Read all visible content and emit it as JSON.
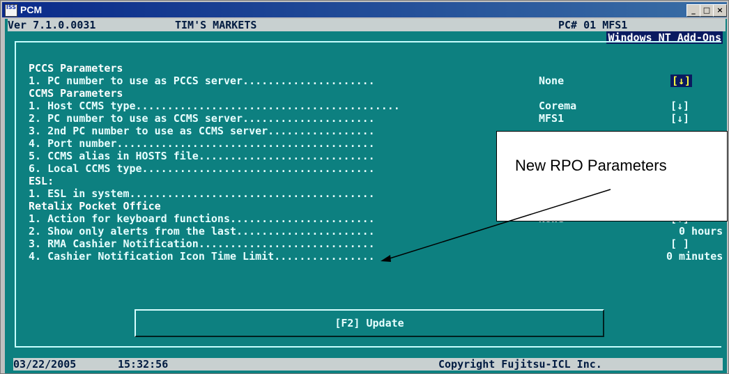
{
  "window": {
    "title": "PCM",
    "icon": "ISS"
  },
  "header": {
    "version": "Ver 7.1.0.0031",
    "store": "TIM'S MARKETS",
    "pc": "PC# 01 MFS1",
    "module": "Windows NT Add-Ons"
  },
  "rows": [
    {
      "text": "PCCS Parameters",
      "kind": "section"
    },
    {
      "text": "1. PC number to use as PCCS server.....................",
      "value": "None",
      "check": "[↓]",
      "active": true
    },
    {
      "text": "CCMS Parameters",
      "kind": "section"
    },
    {
      "text": "1. Host CCMS type..........................................",
      "value": "Corema",
      "check": "[↓]"
    },
    {
      "text": "2. PC number to use as CCMS server.....................",
      "value": "MFS1",
      "check": "[↓]"
    },
    {
      "text": "3. 2nd PC number to use as CCMS server.................",
      "value": "",
      "check": ""
    },
    {
      "text": "4. Port number.........................................",
      "value": "",
      "check": ""
    },
    {
      "text": "5. CCMS alias in HOSTS file............................",
      "value": "",
      "check": ""
    },
    {
      "text": "6. Local CCMS type.....................................",
      "value": "",
      "check": ""
    },
    {
      "text": "ESL:",
      "kind": "section"
    },
    {
      "text": "1. ESL in system.......................................",
      "value": "",
      "check": ""
    },
    {
      "text": "Retalix Pocket Office",
      "kind": "section"
    },
    {
      "text": "1. Action for keyboard functions.......................",
      "value": "None",
      "check": "[↓]"
    },
    {
      "text": "2. Show only alerts from the last......................",
      "value": "",
      "check": "0 hours"
    },
    {
      "text": "3. RMA Cashier Notification............................",
      "value": "",
      "check": "[ ]"
    },
    {
      "text": "4. Cashier Notification Icon Time Limit................",
      "value": "",
      "check": "0 minutes"
    }
  ],
  "update_button": "[F2] Update",
  "status": {
    "date": "03/22/2005",
    "time": "15:32:56",
    "copyright": "Copyright Fujitsu-ICL Inc."
  },
  "callout": {
    "text": "New RPO Parameters"
  },
  "colors": {
    "screen": "#0d8080",
    "header": "#c8d0d0",
    "highlight": "#0a1a60"
  }
}
